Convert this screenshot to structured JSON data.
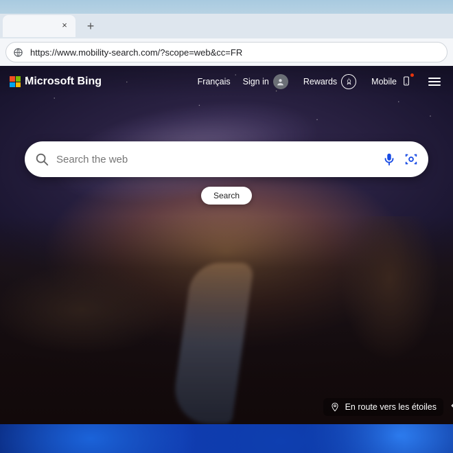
{
  "browser": {
    "url": "https://www.mobility-search.com/?scope=web&cc=FR"
  },
  "header": {
    "brand": "Microsoft Bing",
    "language": "Français",
    "sign_in": "Sign in",
    "rewards": "Rewards",
    "mobile": "Mobile"
  },
  "search": {
    "placeholder": "Search the web",
    "button": "Search"
  },
  "credit": {
    "text": "En route vers les étoiles"
  }
}
